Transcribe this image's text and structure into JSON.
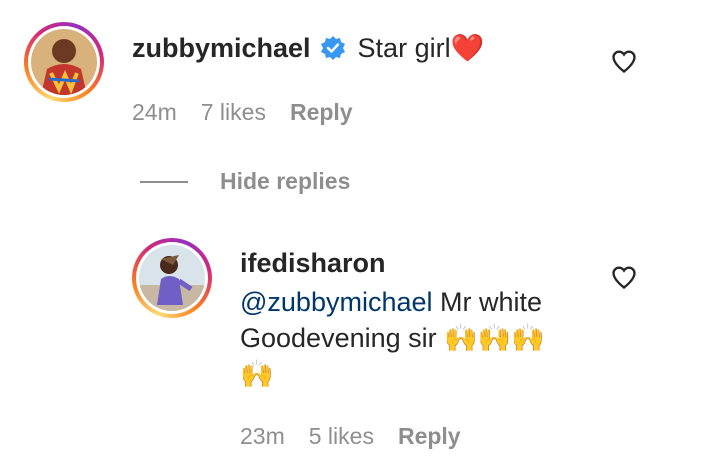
{
  "comment1": {
    "username": "zubbymichael",
    "text": "Star girl❤️",
    "time": "24m",
    "likes": "7 likes",
    "reply_label": "Reply"
  },
  "thread": {
    "hide_replies_label": "Hide replies"
  },
  "comment2": {
    "username": "ifedisharon",
    "mention": "@zubbymichael",
    "line1_text": " Mr white",
    "line2_text": "Goodevening sir 🙌🙌🙌",
    "line3_text": "🙌",
    "time": "23m",
    "likes": "5 likes",
    "reply_label": "Reply"
  },
  "colors": {
    "verified": "#3897f0",
    "mention": "#00376b",
    "meta": "#8e8e8e"
  },
  "icons": {
    "like": "heart-outline-icon",
    "verified": "verified-badge-icon"
  }
}
